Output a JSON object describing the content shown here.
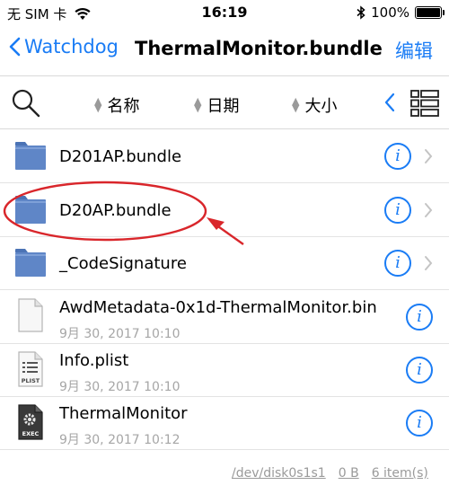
{
  "status_bar": {
    "carrier": "无 SIM 卡",
    "time": "16:19",
    "battery_text": "100%",
    "battery_level": 1.0,
    "icons": [
      "wifi-icon",
      "bluetooth-icon",
      "battery-icon"
    ]
  },
  "nav": {
    "back_label": "Watchdog",
    "title": "ThermalMonitor.bundle",
    "edit_label": "编辑"
  },
  "toolbar": {
    "sort_name": "名称",
    "sort_date": "日期",
    "sort_size": "大小",
    "icons": [
      "search-icon",
      "chevron-left-icon",
      "list-view-icon"
    ]
  },
  "files": [
    {
      "name": "D201AP.bundle",
      "type": "folder"
    },
    {
      "name": "D20AP.bundle",
      "type": "folder"
    },
    {
      "name": "_CodeSignature",
      "type": "folder"
    },
    {
      "name": "AwdMetadata-0x1d-ThermalMonitor.bin",
      "date": "9月 30, 2017 10:10",
      "type": "file"
    },
    {
      "name": "Info.plist",
      "date": "9月 30, 2017 10:10",
      "type": "plist",
      "icon_label": "PLIST"
    },
    {
      "name": "ThermalMonitor",
      "date": "9月 30, 2017 10:12",
      "type": "exec",
      "icon_label": "EXEC"
    }
  ],
  "footer": {
    "path": "/dev/disk0s1s1",
    "size": "0 B",
    "count": "6 item(s)"
  },
  "colors": {
    "accent": "#1a7cf5",
    "folder": "#5f86c7",
    "annotation": "#d9262b"
  }
}
